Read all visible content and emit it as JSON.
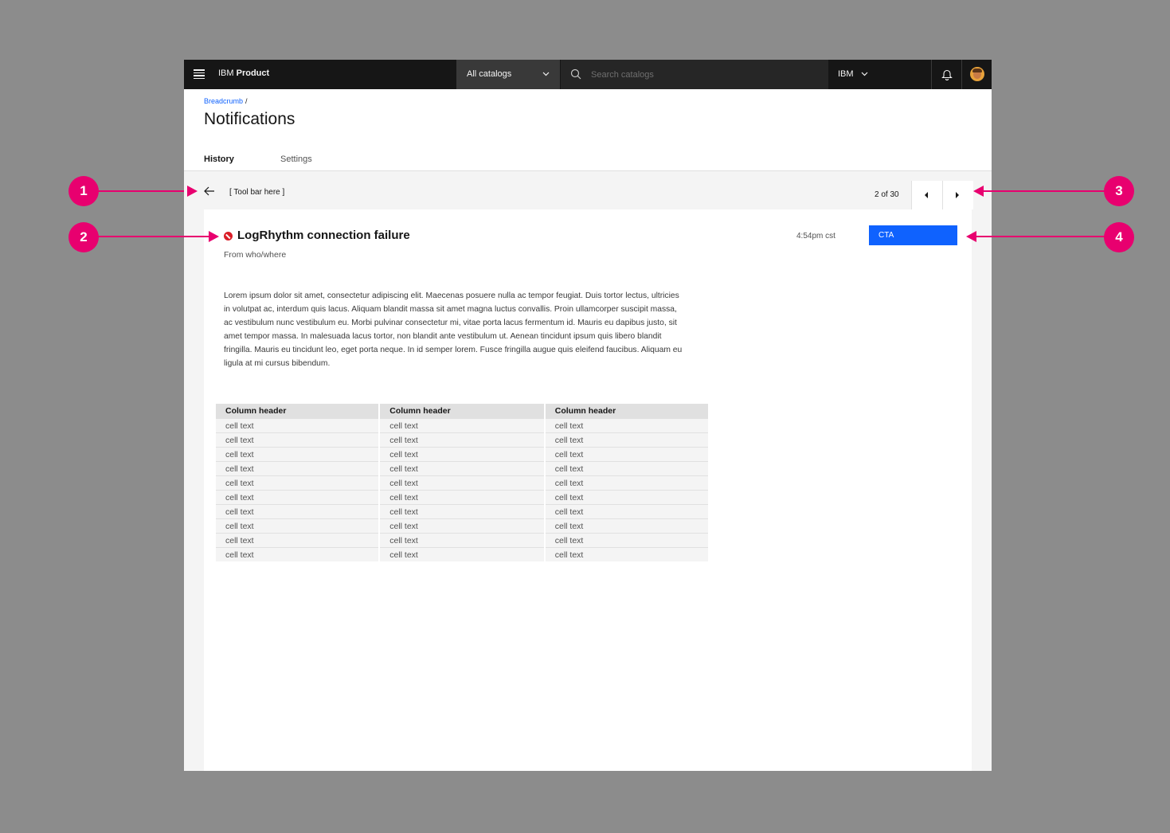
{
  "header": {
    "brand_prefix": "IBM",
    "brand_name": "Product",
    "catalog_select": "All catalogs",
    "search_placeholder": "Search catalogs",
    "org": "IBM"
  },
  "breadcrumb": {
    "link": "Breadcrumb",
    "separator": "/"
  },
  "page_title": "Notifications",
  "tabs": [
    {
      "label": "History",
      "selected": true
    },
    {
      "label": "Settings",
      "selected": false
    }
  ],
  "toolbar": {
    "text": "[ Tool bar here ]"
  },
  "pager": {
    "count": "2 of 30"
  },
  "notification": {
    "title": "LogRhythm connection failure",
    "source": "From who/where",
    "time": "4:54pm cst",
    "cta": "CTA",
    "body": "Lorem ipsum dolor sit amet, consectetur adipiscing elit. Maecenas posuere nulla ac tempor feugiat. Duis tortor lectus, ultricies in volutpat ac, interdum quis lacus. Aliquam blandit massa sit amet magna luctus convallis. Proin ullamcorper suscipit massa, ac vestibulum nunc vestibulum eu. Morbi pulvinar consectetur mi, vitae porta lacus fermentum id. Mauris eu dapibus justo, sit amet tempor massa. In malesuada lacus tortor, non blandit ante vestibulum ut. Aenean tincidunt ipsum quis libero blandit fringilla. Mauris eu tincidunt leo, eget porta neque. In id semper lorem. Fusce fringilla augue quis eleifend faucibus. Aliquam eu ligula at mi cursus bibendum."
  },
  "table": {
    "headers": [
      "Column header",
      "Column header",
      "Column header"
    ],
    "rows": [
      [
        "cell text",
        "cell text",
        "cell text"
      ],
      [
        "cell text",
        "cell text",
        "cell text"
      ],
      [
        "cell text",
        "cell text",
        "cell text"
      ],
      [
        "cell text",
        "cell text",
        "cell text"
      ],
      [
        "cell text",
        "cell text",
        "cell text"
      ],
      [
        "cell text",
        "cell text",
        "cell text"
      ],
      [
        "cell text",
        "cell text",
        "cell text"
      ],
      [
        "cell text",
        "cell text",
        "cell text"
      ],
      [
        "cell text",
        "cell text",
        "cell text"
      ],
      [
        "cell text",
        "cell text",
        "cell text"
      ]
    ]
  },
  "callouts": [
    "1",
    "2",
    "3",
    "4"
  ],
  "colors": {
    "header_bg": "#161616",
    "accent": "#0f62fe",
    "error": "#da1e28",
    "callout": "#e8006f"
  },
  "icons": [
    "menu-icon",
    "chevron-down-icon",
    "search-icon",
    "bell-icon",
    "avatar",
    "arrow-left-icon",
    "caret-left-icon",
    "caret-right-icon",
    "error-filled-icon"
  ]
}
